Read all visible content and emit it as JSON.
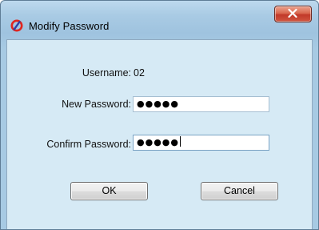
{
  "window": {
    "title": "Modify Password",
    "icon": "red-circle-slash-icon",
    "close_glyph": "✕"
  },
  "form": {
    "username_label": "Username:",
    "username_value": "02",
    "new_password_label": "New Password:",
    "new_password_value": "●●●●●",
    "confirm_password_label": "Confirm Password:",
    "confirm_password_value": "●●●●●"
  },
  "buttons": {
    "ok_label": "OK",
    "cancel_label": "Cancel"
  },
  "colors": {
    "title_bar": "#a9cbe4",
    "client_area": "#d6eaf5",
    "close_button": "#c1392a",
    "app_icon_red": "#e0261f",
    "app_icon_blue": "#2f3fa8"
  }
}
